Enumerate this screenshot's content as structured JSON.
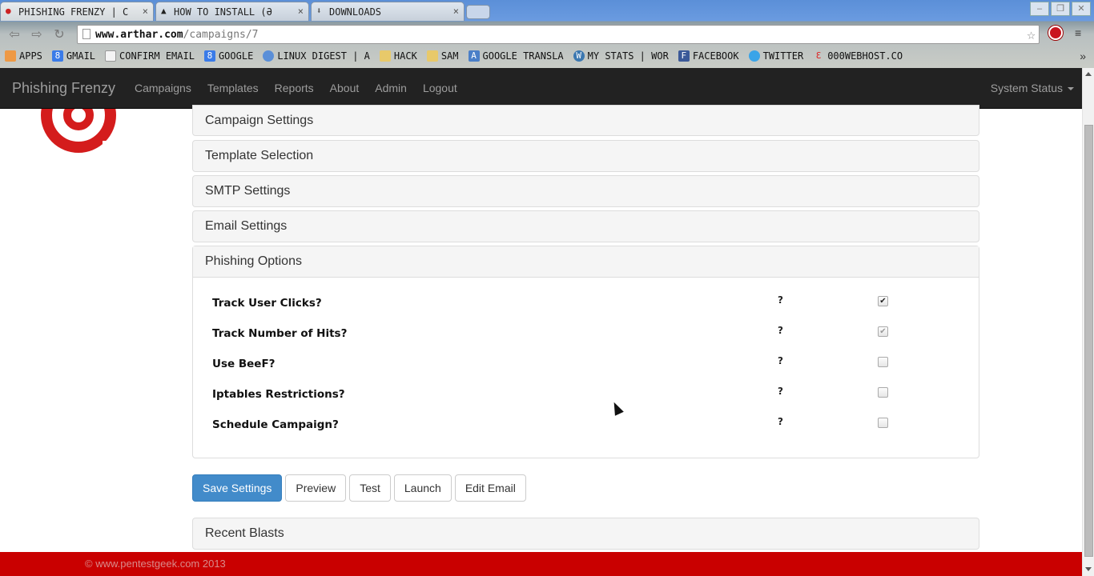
{
  "browser": {
    "tabs": [
      {
        "title": "Phishing Frenzy | C",
        "icon": "bug-icon",
        "active": true
      },
      {
        "title": "How to Install (ə",
        "icon": "linux-icon",
        "active": false
      },
      {
        "title": "Downloads",
        "icon": "download-icon",
        "active": false
      }
    ],
    "close_glyph": "×",
    "url_host": "www.arthar.com",
    "url_path": "/campaigns/7",
    "bookmarks": [
      {
        "label": "Apps",
        "icon": "apps-icon",
        "color": "#e94"
      },
      {
        "label": "Gmail",
        "icon": "google-icon",
        "color": "#3a7be8"
      },
      {
        "label": "Confirm Email",
        "icon": "page-icon",
        "color": "#eee"
      },
      {
        "label": "Google",
        "icon": "google-icon",
        "color": "#3a7be8"
      },
      {
        "label": "Linux Digest | A",
        "icon": "linux-icon",
        "color": "#5a8fd8"
      },
      {
        "label": "Hack",
        "icon": "folder-icon",
        "color": "#e8c96a"
      },
      {
        "label": "Sam",
        "icon": "folder-icon",
        "color": "#e8c96a"
      },
      {
        "label": "Google Transla",
        "icon": "translate-icon",
        "color": "#4a7fc8"
      },
      {
        "label": "My Stats | Wor",
        "icon": "wordpress-icon",
        "color": "#3b77b0"
      },
      {
        "label": "Facebook",
        "icon": "facebook-icon",
        "color": "#3b5998"
      },
      {
        "label": "Twitter",
        "icon": "twitter-icon",
        "color": "#3aa4e8"
      },
      {
        "label": "000webhost.co",
        "icon": "webhost-icon",
        "color": "#d22"
      }
    ],
    "more_glyph": "»"
  },
  "navbar": {
    "brand": "Phishing Frenzy",
    "links": [
      "Campaigns",
      "Templates",
      "Reports",
      "About",
      "Admin",
      "Logout"
    ],
    "system_status": "System Status"
  },
  "panels": {
    "campaign_settings": "Campaign Settings",
    "template_selection": "Template Selection",
    "smtp_settings": "SMTP Settings",
    "email_settings": "Email Settings",
    "phishing_options": "Phishing Options",
    "recent_blasts": "Recent Blasts"
  },
  "options": [
    {
      "label": "Track User Clicks?",
      "help": "?",
      "checked": true,
      "disabled": false
    },
    {
      "label": "Track Number of Hits?",
      "help": "?",
      "checked": true,
      "disabled": true
    },
    {
      "label": "Use BeeF?",
      "help": "?",
      "checked": false,
      "disabled": false
    },
    {
      "label": "Iptables Restrictions?",
      "help": "?",
      "checked": false,
      "disabled": false
    },
    {
      "label": "Schedule Campaign?",
      "help": "?",
      "checked": false,
      "disabled": false
    }
  ],
  "buttons": {
    "save": "Save Settings",
    "preview": "Preview",
    "test": "Test",
    "launch": "Launch",
    "edit_email": "Edit Email"
  },
  "footer": "© www.pentestgeek.com 2013",
  "colors": {
    "primary": "#428bca",
    "footer": "#c90000",
    "navbar": "#222222"
  }
}
